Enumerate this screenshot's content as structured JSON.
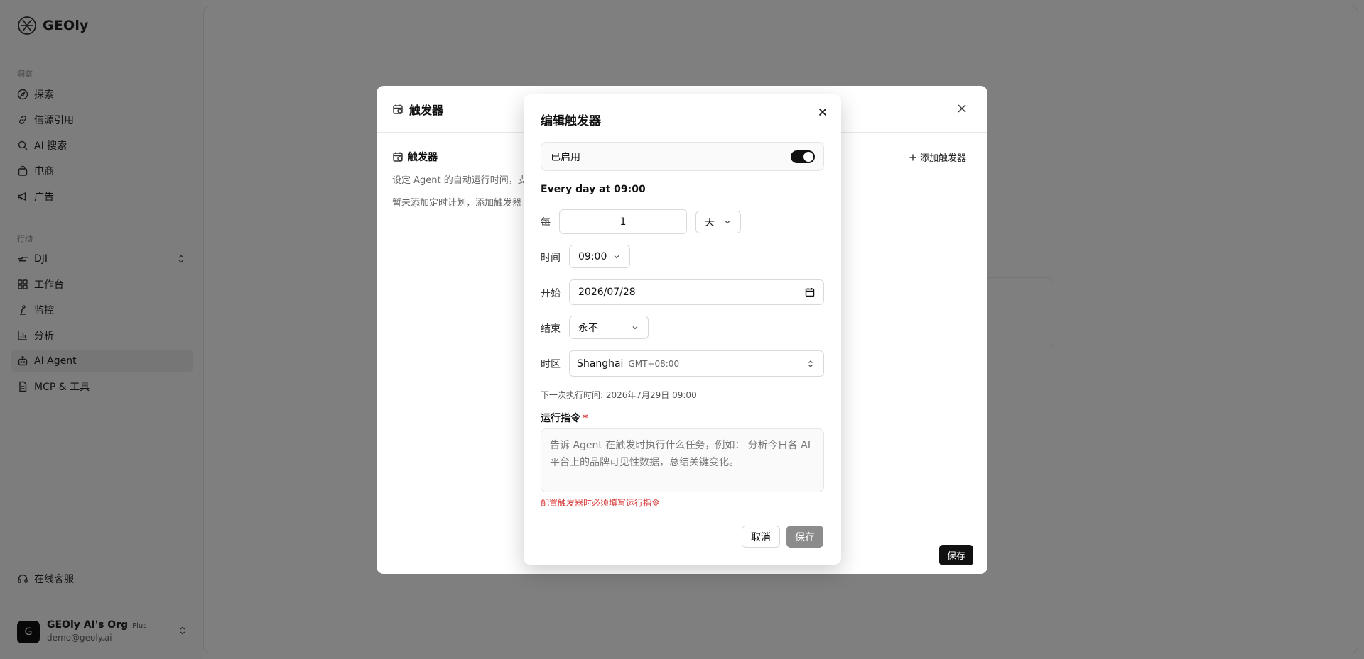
{
  "app": {
    "name": "GEOly"
  },
  "sidebar": {
    "section_insights": "洞察",
    "insights": [
      {
        "label": "探索",
        "icon": "compass-icon"
      },
      {
        "label": "信源引用",
        "icon": "link-icon"
      },
      {
        "label": "AI 搜索",
        "icon": "search-icon"
      },
      {
        "label": "电商",
        "icon": "shopping-bag-icon"
      },
      {
        "label": "广告",
        "icon": "megaphone-icon"
      }
    ],
    "section_actions": "行动",
    "brand_selector": "DJI",
    "actions": [
      {
        "label": "工作台",
        "icon": "grid-icon"
      },
      {
        "label": "监控",
        "icon": "monitor-icon"
      },
      {
        "label": "分析",
        "icon": "bar-chart-icon"
      },
      {
        "label": "AI Agent",
        "icon": "bot-icon",
        "active": true
      },
      {
        "label": "MCP & 工具",
        "icon": "file-icon"
      }
    ],
    "support": "在线客服",
    "account": {
      "initial": "G",
      "name": "GEOly AI's Org",
      "plan": "Plus",
      "email": "demo@geoly.ai"
    }
  },
  "trigger_dialog": {
    "title": "触发器",
    "section_title": "触发器",
    "add_button": "添加触发器",
    "description": "设定 Agent 的自动运行时间，支",
    "empty_text": "暂未添加定时计划，添加触发器",
    "save_button": "保存"
  },
  "edit_dialog": {
    "title": "编辑触发器",
    "enabled_label": "已启用",
    "enabled": true,
    "summary": "Every day at 09:00",
    "every_label": "每",
    "every_value": "1",
    "unit_value": "天",
    "time_label": "时间",
    "time_value": "09:00",
    "start_label": "开始",
    "start_value": "2026/07/28",
    "end_label": "结束",
    "end_value": "永不",
    "timezone_label": "时区",
    "timezone_name": "Shanghai",
    "timezone_offset": "GMT+08:00",
    "next_run": "下一次执行时间: 2026年7月29日 09:00",
    "command_label": "运行指令",
    "required_mark": "*",
    "command_placeholder": "告诉 Agent 在触发时执行什么任务，例如： 分析今日各 AI 平台上的品牌可见性数据，总结关键变化。",
    "error": "配置触发器时必须填写运行指令",
    "cancel_button": "取消",
    "save_button": "保存"
  },
  "colors": {
    "overlay": "#00000080",
    "primary": "#111111",
    "error": "#d83b3b",
    "disabled_button": "#8c8c8c"
  }
}
